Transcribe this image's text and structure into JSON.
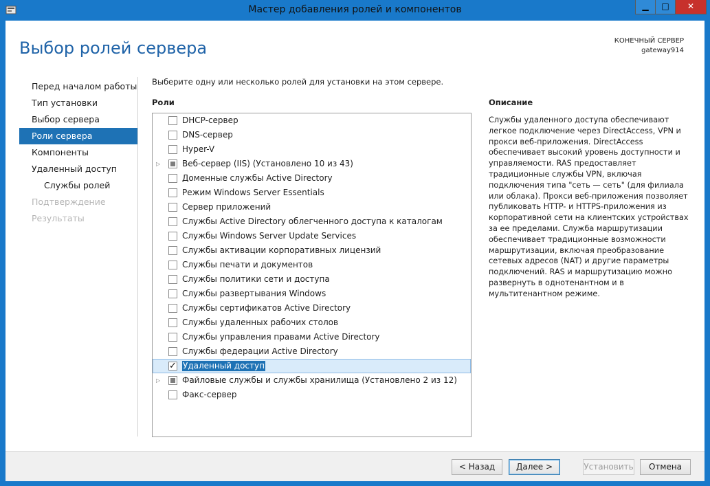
{
  "window": {
    "title": "Мастер добавления ролей и компонентов",
    "minimize_glyph": "▁",
    "maximize_glyph": "□",
    "close_glyph": "✕"
  },
  "header": {
    "page_title": "Выбор ролей сервера",
    "destination_label": "КОНЕЧНЫЙ СЕРВЕР",
    "destination_name": "gateway914"
  },
  "nav": {
    "items": [
      {
        "label": "Перед началом работы",
        "state": "normal",
        "level": 0
      },
      {
        "label": "Тип установки",
        "state": "normal",
        "level": 0
      },
      {
        "label": "Выбор сервера",
        "state": "normal",
        "level": 0
      },
      {
        "label": "Роли сервера",
        "state": "active",
        "level": 0
      },
      {
        "label": "Компоненты",
        "state": "normal",
        "level": 0
      },
      {
        "label": "Удаленный доступ",
        "state": "normal",
        "level": 0
      },
      {
        "label": "Службы ролей",
        "state": "normal",
        "level": 1
      },
      {
        "label": "Подтверждение",
        "state": "disabled",
        "level": 0
      },
      {
        "label": "Результаты",
        "state": "disabled",
        "level": 0
      }
    ]
  },
  "main": {
    "instruction": "Выберите одну или несколько ролей для установки на этом сервере.",
    "roles_heading": "Роли",
    "roles": [
      {
        "label": "DHCP-сервер",
        "state": "unchecked",
        "expandable": false
      },
      {
        "label": "DNS-сервер",
        "state": "unchecked",
        "expandable": false
      },
      {
        "label": "Hyper-V",
        "state": "unchecked",
        "expandable": false
      },
      {
        "label": "Веб-сервер (IIS) (Установлено 10 из 43)",
        "state": "partial",
        "expandable": true
      },
      {
        "label": "Доменные службы Active Directory",
        "state": "unchecked",
        "expandable": false
      },
      {
        "label": "Режим Windows Server Essentials",
        "state": "unchecked",
        "expandable": false
      },
      {
        "label": "Сервер приложений",
        "state": "unchecked",
        "expandable": false
      },
      {
        "label": "Службы Active Directory облегченного доступа к каталогам",
        "state": "unchecked",
        "expandable": false
      },
      {
        "label": "Службы Windows Server Update Services",
        "state": "unchecked",
        "expandable": false
      },
      {
        "label": "Службы активации корпоративных лицензий",
        "state": "unchecked",
        "expandable": false
      },
      {
        "label": "Службы печати и документов",
        "state": "unchecked",
        "expandable": false
      },
      {
        "label": "Службы политики сети и доступа",
        "state": "unchecked",
        "expandable": false
      },
      {
        "label": "Службы развертывания Windows",
        "state": "unchecked",
        "expandable": false
      },
      {
        "label": "Службы сертификатов Active Directory",
        "state": "unchecked",
        "expandable": false
      },
      {
        "label": "Службы удаленных рабочих столов",
        "state": "unchecked",
        "expandable": false
      },
      {
        "label": "Службы управления правами Active Directory",
        "state": "unchecked",
        "expandable": false
      },
      {
        "label": "Службы федерации Active Directory",
        "state": "unchecked",
        "expandable": false
      },
      {
        "label": "Удаленный доступ",
        "state": "checked",
        "expandable": false,
        "selected": true
      },
      {
        "label": "Файловые службы и службы хранилища (Установлено 2 из 12)",
        "state": "partial",
        "expandable": true
      },
      {
        "label": "Факс-сервер",
        "state": "unchecked",
        "expandable": false
      }
    ]
  },
  "description": {
    "heading": "Описание",
    "text": "Службы удаленного доступа обеспечивают легкое подключение через DirectAccess, VPN и прокси веб-приложения. DirectAccess обеспечивает высокий уровень доступности и управляемости. RAS предоставляет традиционные службы VPN, включая подключения типа \"сеть — сеть\" (для филиала или облака). Прокси веб-приложения позволяет публиковать HTTP- и HTTPS-приложения из корпоративной сети на клиентских устройствах за ее пределами. Служба маршрутизации обеспечивает традиционные возможности маршрутизации, включая преобразование сетевых адресов (NAT) и другие параметры подключений. RAS и маршрутизацию можно развернуть в однотенантном и в мультитенантном режиме."
  },
  "footer": {
    "back_label": "< Назад",
    "next_label": "Далее >",
    "install_label": "Установить",
    "cancel_label": "Отмена"
  },
  "colors": {
    "frame": "#1979ca",
    "title_accent": "#1f63a8",
    "nav_active": "#1e72b5",
    "close_button": "#c7312c"
  }
}
